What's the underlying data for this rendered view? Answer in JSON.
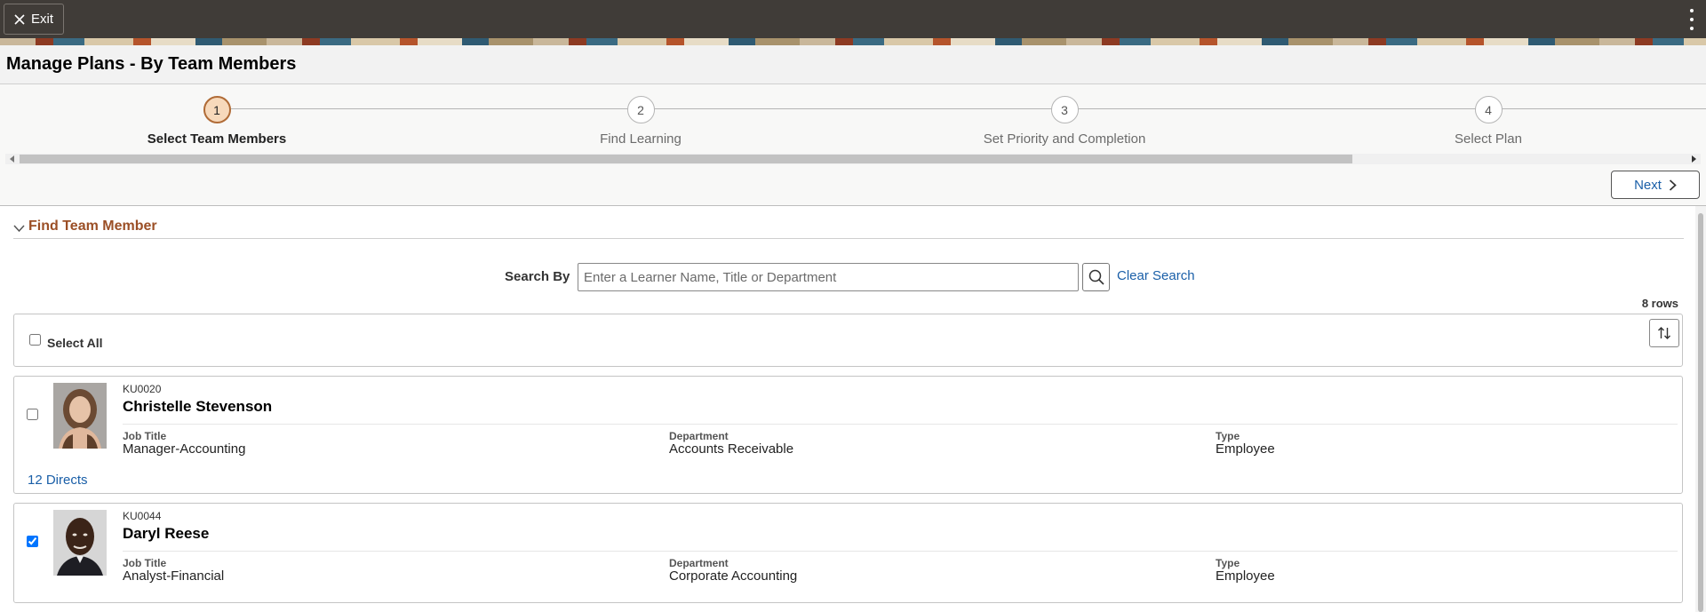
{
  "topbar": {
    "exit_label": "Exit"
  },
  "page": {
    "title": "Manage Plans - By Team Members"
  },
  "steps": [
    {
      "number": "1",
      "label": "Select Team Members",
      "active": true
    },
    {
      "number": "2",
      "label": "Find Learning",
      "active": false
    },
    {
      "number": "3",
      "label": "Set Priority and Completion",
      "active": false
    },
    {
      "number": "4",
      "label": "Select Plan",
      "active": false
    }
  ],
  "nav": {
    "next_label": "Next"
  },
  "section": {
    "title": "Find Team Member"
  },
  "search": {
    "label": "Search By",
    "placeholder": "Enter a Learner Name, Title or Department",
    "value": "",
    "clear_label": "Clear Search"
  },
  "results": {
    "count_label": "8 rows",
    "select_all_label": "Select All"
  },
  "members": [
    {
      "id": "KU0020",
      "name": "Christelle Stevenson",
      "checked": false,
      "job_title_label": "Job Title",
      "job_title": "Manager-Accounting",
      "department_label": "Department",
      "department": "Accounts Receivable",
      "type_label": "Type",
      "type": "Employee",
      "directs_label": "12 Directs"
    },
    {
      "id": "KU0044",
      "name": "Daryl Reese",
      "checked": true,
      "job_title_label": "Job Title",
      "job_title": "Analyst-Financial",
      "department_label": "Department",
      "department": "Corporate Accounting",
      "type_label": "Type",
      "type": "Employee"
    }
  ],
  "colors": {
    "topbar": "#403c38",
    "accent_section": "#9b4f26",
    "link": "#1a5fa8",
    "active_step_fill": "#f7d9bb",
    "active_step_border": "#b06b36"
  }
}
